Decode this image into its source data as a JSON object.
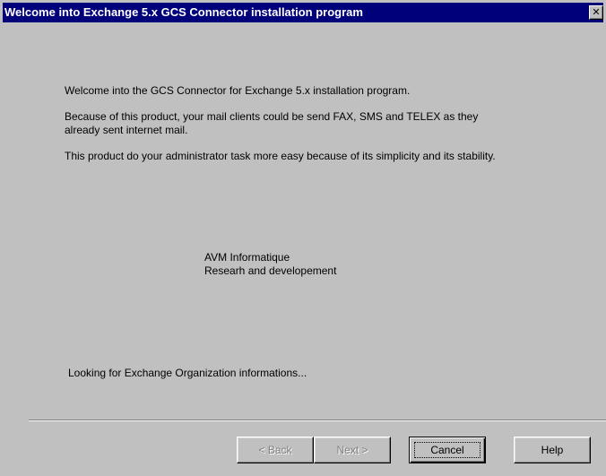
{
  "window": {
    "title": "Welcome into Exchange 5.x GCS Connector installation program",
    "close_glyph": "✕"
  },
  "content": {
    "welcome": "Welcome into the GCS Connector for Exchange 5.x installation program.",
    "because_line1": "Because of this product, your mail clients could be send FAX, SMS and TELEX as they",
    "because_line2": "already sent internet mail.",
    "task": "This product do your administrator task more easy because of its simplicity and its stability.",
    "company": "AVM Informatique",
    "department": "Researh and developement",
    "status": "Looking for Exchange Organization informations..."
  },
  "buttons": {
    "back_label": "< Back",
    "next_label": "Next >",
    "cancel_label": "Cancel",
    "help_label": "Help"
  }
}
